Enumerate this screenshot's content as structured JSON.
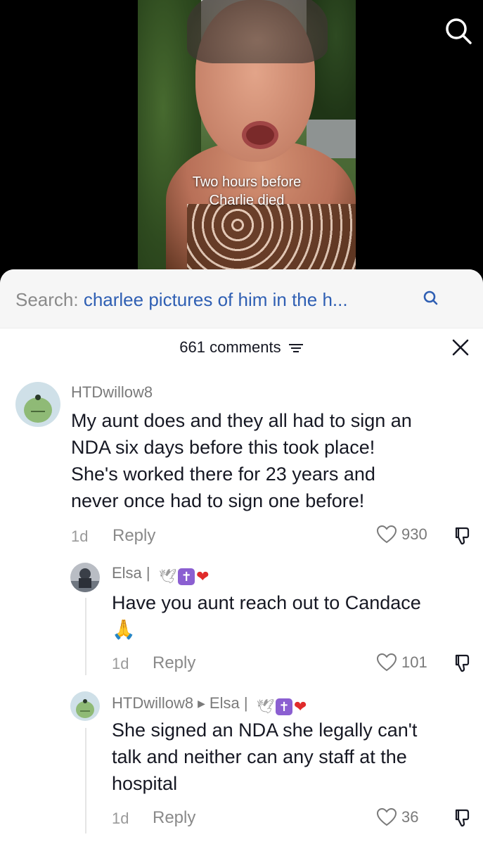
{
  "video": {
    "caption_line1": "Two hours before",
    "caption_line2": "Charlie died"
  },
  "search": {
    "label": "Search: ",
    "query": "charlee pictures of him in the h..."
  },
  "comments_header": {
    "count_label": "661 comments"
  },
  "comments": [
    {
      "username": "HTDwillow8",
      "text_lines": [
        "My aunt does and they all had to sign an",
        "NDA six days before this took place!",
        "She's worked there for 23 years and",
        "never once had to sign one before!"
      ],
      "time": "1d",
      "reply_label": "Reply",
      "likes": "930"
    },
    {
      "username": "Elsa |",
      "emoji_dove": "🕊",
      "emoji_cross": "✝",
      "emoji_heart": "❤",
      "text_lines": [
        "Have you aunt reach out to Candace",
        "🙏"
      ],
      "time": "1d",
      "reply_label": "Reply",
      "likes": "101"
    },
    {
      "username": "HTDwillow8",
      "reply_to": "Elsa |",
      "emoji_dove": "🕊",
      "emoji_cross": "✝",
      "emoji_heart": "❤",
      "text_lines": [
        "She signed an NDA she legally can't",
        "talk and neither can any staff at the",
        "hospital"
      ],
      "time": "1d",
      "reply_label": "Reply",
      "likes": "36"
    }
  ],
  "colors": {
    "accent_query": "#2f5fb3",
    "avatar_green": "#8fba76"
  }
}
